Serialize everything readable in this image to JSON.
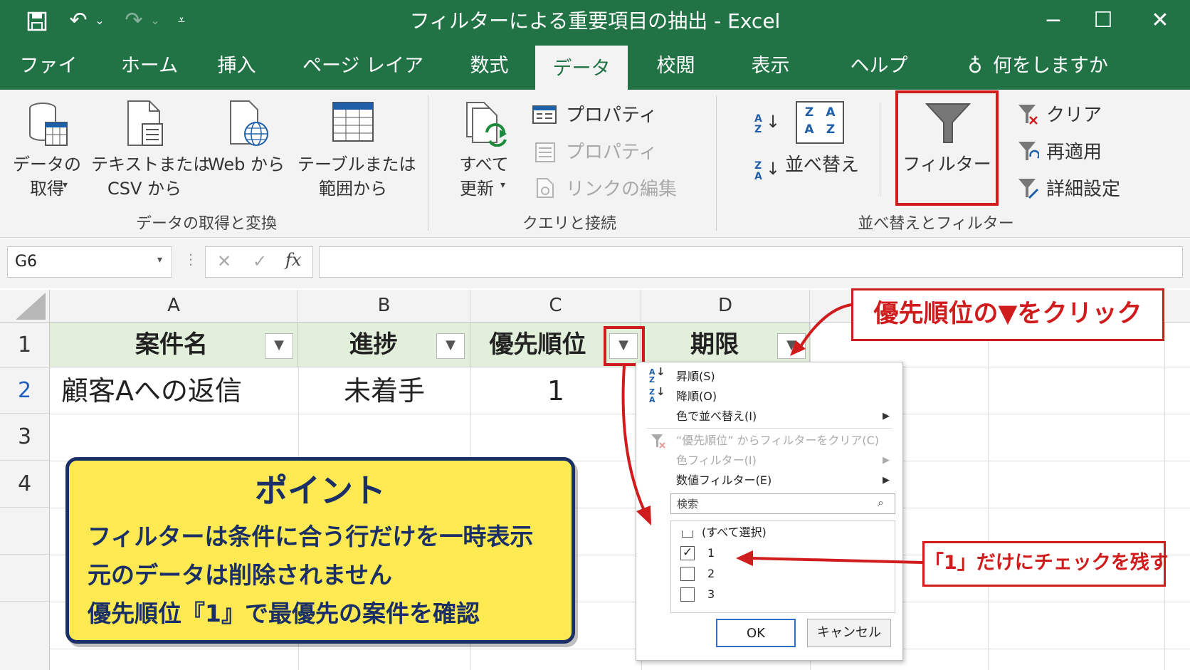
{
  "window": {
    "title": "フィルターによる重要項目の抽出 - Excel"
  },
  "tabs": [
    "ファイル",
    "ホーム",
    "挿入",
    "ページ レイアウト",
    "数式",
    "データ",
    "校閲",
    "表示",
    "ヘルプ"
  ],
  "active_tab": "データ",
  "tell_me": "何をしますか",
  "ribbon": {
    "get_data_1": "データの",
    "get_data_2": "取得",
    "text_csv_1": "テキストまたは",
    "text_csv_2": "CSV から",
    "web": "Web から",
    "table_1": "テーブルまたは",
    "table_2": "範囲から",
    "group1": "データの取得と変換",
    "refresh_1": "すべて",
    "refresh_2": "更新",
    "props1": "プロパティ",
    "props2": "プロパティ",
    "edit_links": "リンクの編集",
    "group2": "クエリと接続",
    "sort": "並べ替え",
    "sort_az": "A Z",
    "sort_za": "Z A",
    "filter": "フィルター",
    "clear": "クリア",
    "reapply": "再適用",
    "advanced": "詳細設定",
    "group3": "並べ替えとフィルター"
  },
  "formula": {
    "name_box": "G6",
    "fx": "fx",
    "cancel": "✕",
    "enter": "✓"
  },
  "grid": {
    "columns": [
      "A",
      "B",
      "C",
      "D"
    ],
    "rows": [
      "1",
      "2",
      "3",
      "4"
    ],
    "headers": [
      "案件名",
      "進捗",
      "優先順位",
      "期限"
    ],
    "row2": [
      "顧客Aへの返信",
      "未着手",
      "1"
    ]
  },
  "dropdown": {
    "sort_asc": "昇順(S)",
    "sort_desc": "降順(O)",
    "sort_color": "色で並べ替え(I)",
    "clear": "“優先順位” からフィルターをクリア(C)",
    "color_filter": "色フィルター(I)",
    "number_filter": "数値フィルター(E)",
    "search_placeholder": "検索",
    "select_all": "(すべて選択)",
    "items": [
      {
        "label": "1",
        "checked": true
      },
      {
        "label": "2",
        "checked": false
      },
      {
        "label": "3",
        "checked": false
      }
    ],
    "ok": "OK",
    "cancel": "キャンセル"
  },
  "callouts": {
    "click_arrow": "優先順位の▼をクリック",
    "keep_one": "「1」だけにチェックを残す"
  },
  "point": {
    "title": "ポイント",
    "lines": [
      "フィルターは条件に合う行だけを一時表示",
      "元のデータは削除されません",
      "優先順位『1』で最優先の案件を確認"
    ]
  },
  "colors": {
    "excel_green": "#217346",
    "accent_red": "#d01c1c",
    "header_fill": "#e2efda",
    "note_yellow": "#fdea52",
    "note_navy": "#1a2f66"
  }
}
